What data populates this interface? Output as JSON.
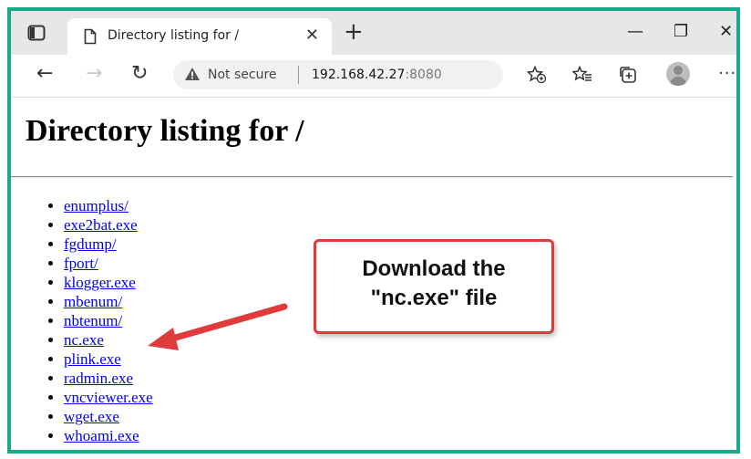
{
  "browser": {
    "tab": {
      "title": "Directory listing for /",
      "close": "✕"
    },
    "new_tab": "+",
    "window_controls": {
      "minimize": "—",
      "restore": "❐",
      "close": "✕"
    },
    "nav": {
      "back": "←",
      "forward": "→",
      "reload": "↻"
    },
    "address": {
      "security": "Not secure",
      "host": "192.168.42.27",
      "port": ":8080"
    },
    "more": "···",
    "icons": [
      "tab-actions-icon",
      "page-icon",
      "warning-icon",
      "add-favorite-icon",
      "favorites-icon",
      "collections-icon",
      "profile-avatar",
      "more-icon"
    ]
  },
  "page": {
    "heading": "Directory listing for /",
    "files": [
      "enumplus/",
      "exe2bat.exe",
      "fgdump/",
      "fport/",
      "klogger.exe",
      "mbenum/",
      "nbtenum/",
      "nc.exe",
      "plink.exe",
      "radmin.exe",
      "vncviewer.exe",
      "wget.exe",
      "whoami.exe"
    ]
  },
  "annotation": {
    "line1": "Download the",
    "line2": "\"nc.exe\" file",
    "color": "#e03a3a"
  },
  "colors": {
    "frame": "#17a98a",
    "link": "#0000ee"
  }
}
